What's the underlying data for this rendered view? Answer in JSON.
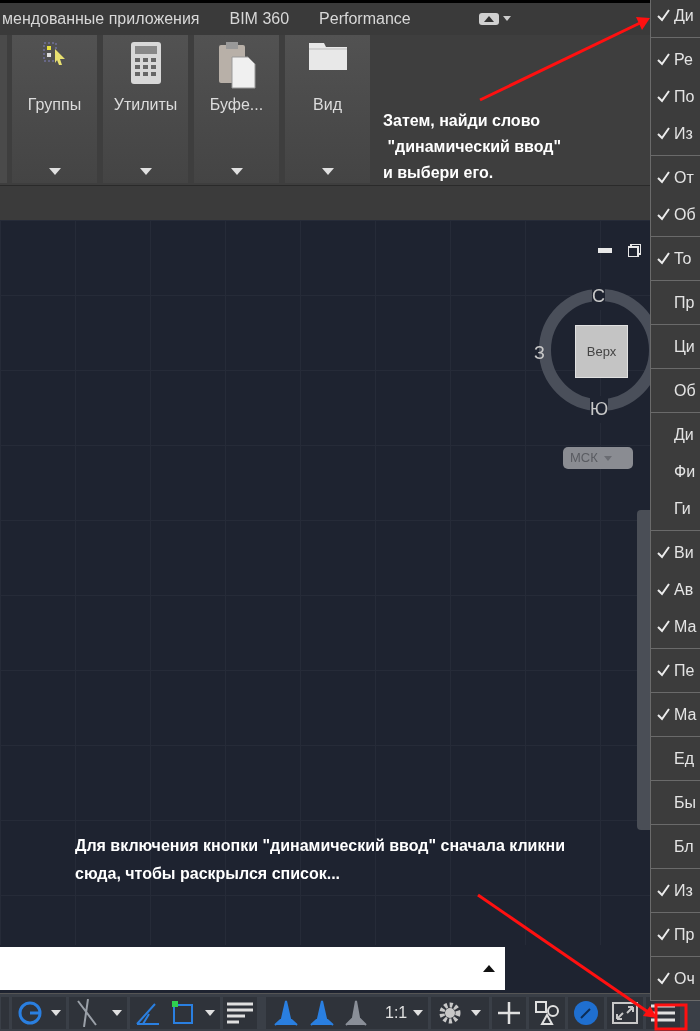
{
  "ribbon_tabs": [
    {
      "label": "мендованные приложения",
      "selected": false
    },
    {
      "label": "BIM 360",
      "selected": false
    },
    {
      "label": "Performance",
      "selected": false
    }
  ],
  "ribbon_panels": [
    {
      "label": "Группы",
      "kind": "groups"
    },
    {
      "label": "Утилиты",
      "kind": "calculator"
    },
    {
      "label": "Буфе...",
      "kind": "clipboard"
    },
    {
      "label": "Вид",
      "kind": "view"
    }
  ],
  "viewcube": {
    "north": "С",
    "west": "З",
    "south": "Ю",
    "face": "Верх",
    "ucs": "МСК"
  },
  "annotations": [
    {
      "text": "Затем, найди слово\n \"динамический ввод\"\nи выбери его."
    },
    {
      "text": "Для включения кнопки \"динамический ввод\" сначала кликни\nсюда, чтобы раскрылся список..."
    }
  ],
  "status_bar": {
    "scale": "1:1"
  },
  "popup_menu": {
    "groups": [
      [
        {
          "label": "Ди",
          "checked": true
        }
      ],
      [
        {
          "label": "Ре",
          "checked": true
        },
        {
          "label": "По",
          "checked": true
        },
        {
          "label": "Из",
          "checked": true
        }
      ],
      [
        {
          "label": "От",
          "checked": true
        },
        {
          "label": "Об",
          "checked": true
        }
      ],
      [
        {
          "label": "То",
          "checked": true
        }
      ],
      [
        {
          "label": "Пр",
          "checked": false
        }
      ],
      [
        {
          "label": "Ци",
          "checked": false
        }
      ],
      [
        {
          "label": "Об",
          "checked": false
        }
      ],
      [
        {
          "label": "Ди",
          "checked": false
        },
        {
          "label": "Фи",
          "checked": false
        },
        {
          "label": "Ги",
          "checked": false
        }
      ],
      [
        {
          "label": "Ви",
          "checked": true
        },
        {
          "label": "Ав",
          "checked": true
        },
        {
          "label": "Ма",
          "checked": true
        }
      ],
      [
        {
          "label": "Пе",
          "checked": true
        }
      ],
      [
        {
          "label": "Ма",
          "checked": true
        }
      ],
      [
        {
          "label": "Ед",
          "checked": false
        }
      ],
      [
        {
          "label": "Бы",
          "checked": false
        }
      ],
      [
        {
          "label": "Бл",
          "checked": false
        }
      ],
      [
        {
          "label": "Из",
          "checked": true
        }
      ],
      [
        {
          "label": "Пр",
          "checked": true
        }
      ],
      [
        {
          "label": "Оч",
          "checked": true
        }
      ]
    ]
  }
}
